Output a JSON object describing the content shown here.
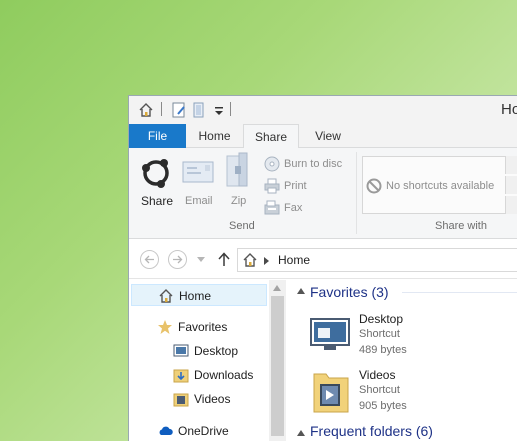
{
  "window": {
    "title": "Ho"
  },
  "quick_access": {
    "icons": [
      "home-icon",
      "properties-icon",
      "new-folder-icon",
      "customize-dropdown-icon"
    ]
  },
  "tabs": [
    {
      "label": "File"
    },
    {
      "label": "Home"
    },
    {
      "label": "Share"
    },
    {
      "label": "View"
    }
  ],
  "ribbon": {
    "share_label": "Share",
    "email_label": "Email",
    "zip_label": "Zip",
    "burn_label": "Burn to disc",
    "print_label": "Print",
    "fax_label": "Fax",
    "send_group": "Send",
    "no_shortcuts": "No shortcuts available",
    "share_with_group": "Share with"
  },
  "address": {
    "path": "Home"
  },
  "nav": {
    "items": [
      {
        "label": "Home",
        "icon": "home-icon"
      },
      {
        "label": "Favorites",
        "icon": "star-icon"
      },
      {
        "label": "Desktop",
        "icon": "desktop-icon"
      },
      {
        "label": "Downloads",
        "icon": "downloads-icon"
      },
      {
        "label": "Videos",
        "icon": "videos-icon"
      },
      {
        "label": "OneDrive",
        "icon": "cloud-icon"
      }
    ]
  },
  "content": {
    "favorites_header": "Favorites (3)",
    "frequent_header": "Frequent folders (6)",
    "items": [
      {
        "name": "Desktop",
        "type": "Shortcut",
        "size": "489 bytes"
      },
      {
        "name": "Videos",
        "type": "Shortcut",
        "size": "905 bytes"
      }
    ]
  },
  "colors": {
    "file_tab": "#1979ca",
    "group_header": "#1e3287",
    "desktop_bg": "#a8d878"
  }
}
